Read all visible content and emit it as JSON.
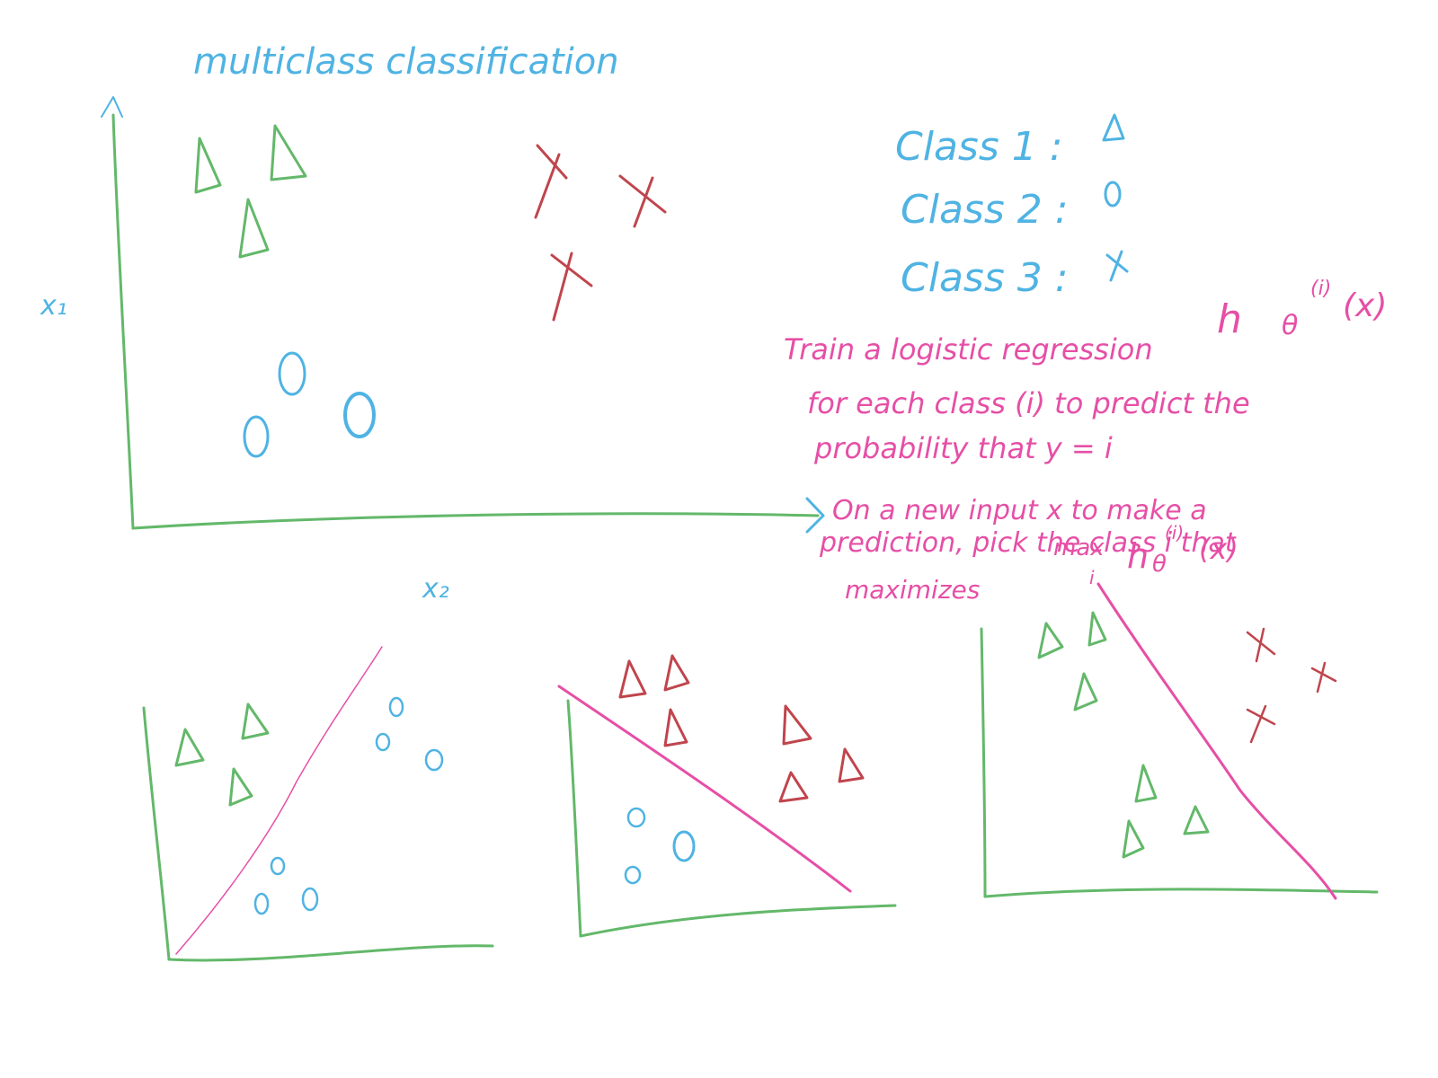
{
  "title": "multiclass classification",
  "axes": {
    "y_label": "x₁",
    "x_label": "x₂"
  },
  "legend": [
    {
      "label": "Class 1 :",
      "symbol": "Δ"
    },
    {
      "label": "Class 2 :",
      "symbol": "o"
    },
    {
      "label": "Class 3 :",
      "symbol": "x"
    }
  ],
  "notes": {
    "line1": "Train a logistic regression",
    "h": "h",
    "theta": "θ",
    "sup_i": "(i)",
    "arg_x": "(x)",
    "line2": "for each class (i) to predict the",
    "line3": "probability that y = i",
    "line4": "On a new input x to make a",
    "line5": "prediction, pick the class i that",
    "line6": "maximizes",
    "max": "max",
    "sub_i": "i"
  },
  "colors": {
    "blue": "#4fb3e3",
    "green": "#63b86a",
    "red": "#c0454d",
    "pink": "#e64fa6"
  }
}
